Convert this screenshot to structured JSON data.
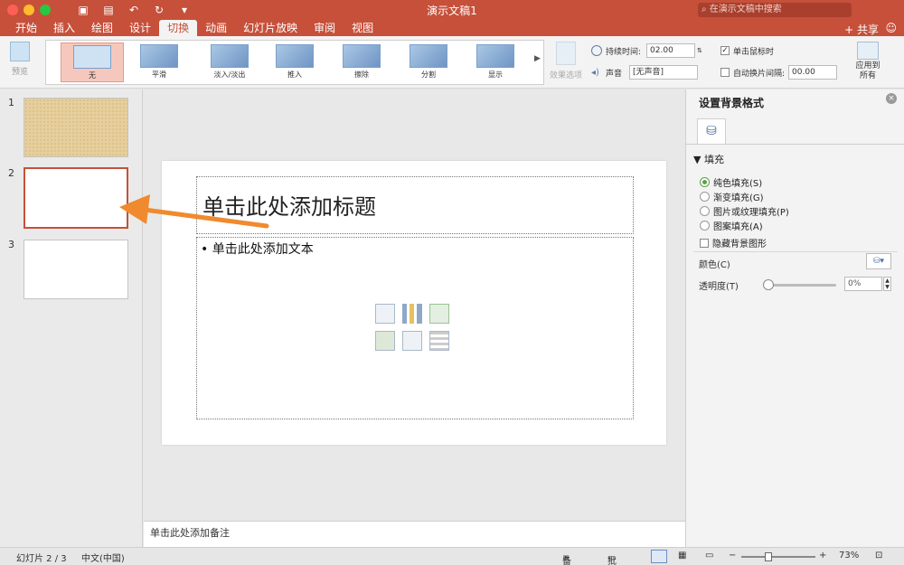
{
  "window": {
    "title": "演示文稿1",
    "search_placeholder": "在演示文稿中搜索",
    "share_label": "共享",
    "smile_icon": "smiley-icon"
  },
  "colors": {
    "accent": "#c7503a",
    "selected_slide_border": "#c7503a",
    "arrow": "#f08a2e"
  },
  "tabs": [
    "开始",
    "插入",
    "绘图",
    "设计",
    "切换",
    "动画",
    "幻灯片放映",
    "审阅",
    "视图"
  ],
  "active_tab": "切换",
  "ribbon": {
    "preview_label": "预览",
    "transitions": [
      "无",
      "平滑",
      "淡入/淡出",
      "推入",
      "擦除",
      "分割",
      "显示"
    ],
    "selected_transition": "无",
    "effect_options_label": "效果选项",
    "duration_label": "持续时间:",
    "duration_value": "02.00",
    "sound_label": "声音",
    "sound_value": "[无声音]",
    "on_click_label": "单击鼠标时",
    "auto_after_label": "自动换片间隔:",
    "auto_after_value": "00.00",
    "apply_all_label_1": "应用到",
    "apply_all_label_2": "所有"
  },
  "slides": [
    {
      "number": "1"
    },
    {
      "number": "2"
    },
    {
      "number": "3"
    }
  ],
  "slide": {
    "title_placeholder": "单击此处添加标题",
    "body_placeholder": "• 单击此处添加文本"
  },
  "notes_placeholder": "单击此处添加备注",
  "format_pane": {
    "title": "设置背景格式",
    "section": "填充",
    "options": [
      "纯色填充(S)",
      "渐变填充(G)",
      "图片或纹理填充(P)",
      "图案填充(A)"
    ],
    "selected_option": "纯色填充(S)",
    "hide_bg_label": "隐藏背景图形",
    "color_label": "颜色(C)",
    "transparency_label": "透明度(T)",
    "transparency_value": "0%"
  },
  "status": {
    "slide_info": "幻灯片 2 / 3",
    "language": "中文(中国)",
    "notes_label": "备注",
    "comments_label": "批注",
    "zoom": "73%"
  }
}
